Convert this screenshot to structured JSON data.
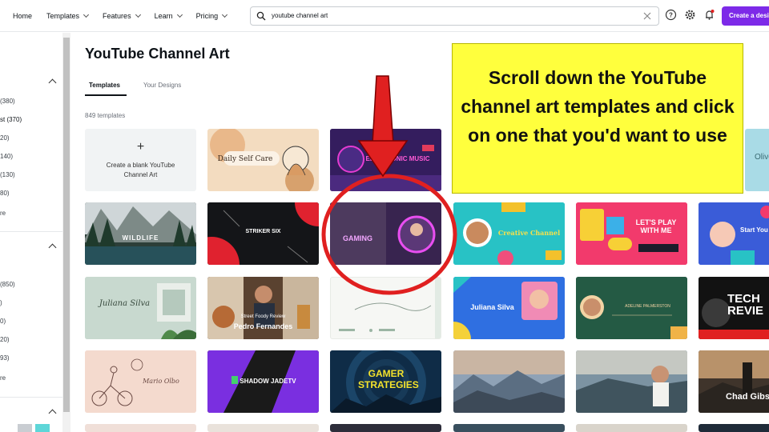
{
  "nav": {
    "home": "Home",
    "templates": "Templates",
    "features": "Features",
    "learn": "Learn",
    "pricing": "Pricing"
  },
  "search": {
    "value": "youtube channel art"
  },
  "create_button": "Create a design",
  "sidebar": {
    "counts_group1": [
      "(380)",
      "st (370)",
      "20)",
      "140)",
      "(130)",
      "80)"
    ],
    "more1": "re",
    "counts_group2": [
      "(850)",
      ")",
      "0)",
      "20)",
      "93)"
    ],
    "more2": "re"
  },
  "page": {
    "title": "YouTube Channel Art",
    "tabs": [
      "Templates",
      "Your Designs"
    ],
    "template_count": "849 templates",
    "blank_card_line1": "Create a blank YouTube",
    "blank_card_line2": "Channel Art"
  },
  "cards": {
    "daily_self_care": "Daily Self Care",
    "electronic_music": "ELECTRONIC MUSIC",
    "wildlife": "WILDLIFE",
    "striker_six": "STRIKER SIX",
    "gaming": "GAMING",
    "creative_channel": "Creative Channel",
    "lets_play": "LET'S PLAY WITH ME",
    "start_your": "Start You",
    "juliana_script": "Juliana Silva",
    "street_foody_review": "Street Foody Review",
    "pedro_fernandes": "Pedro Fernandes",
    "juliana_silva": "Juliana Silva",
    "adeline": "ADELINE PALMERSTON",
    "tech_review": "TECH REVIE",
    "mario_olbo": "Mario Olbo",
    "shadow_jadetv": "SHADOW JADETV",
    "gamer_strategies": "GAMER STRATEGIES",
    "chad_gibbs": "Chad Gibs",
    "oliv": "Olive"
  },
  "callout": {
    "text": "Scroll down the YouTube channel art templates and click on one that you'd want to use"
  },
  "colors": {
    "accent": "#7d2ae8",
    "callout_bg": "#ffff3d",
    "annotation_red": "#e02020"
  }
}
